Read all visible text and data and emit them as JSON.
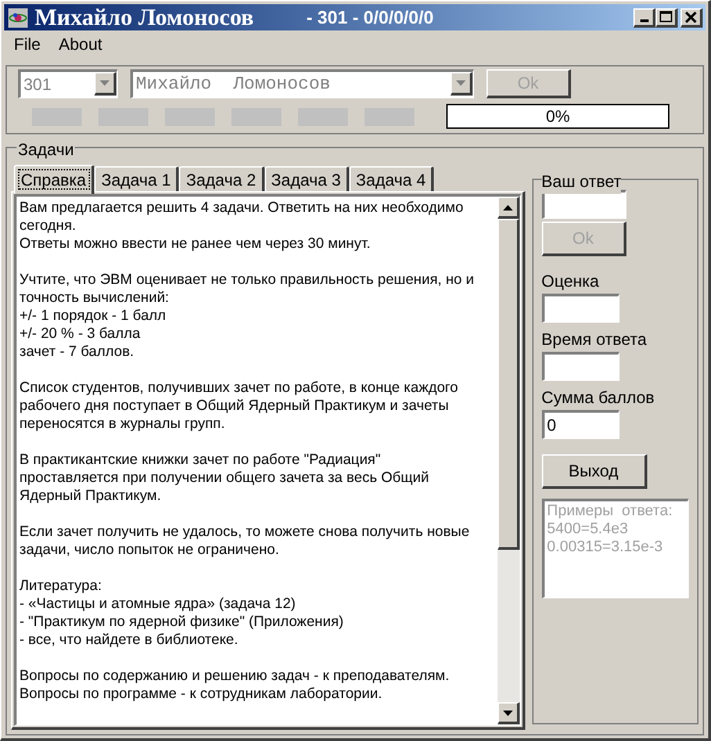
{
  "window": {
    "title": "Михайло Ломоносов",
    "subtitle": "- 301 - 0/0/0/0/0"
  },
  "menu": [
    "File",
    "About"
  ],
  "login": {
    "group": {
      "value": "301",
      "disabled": true
    },
    "student": {
      "value": "Михайло  Ломоносов",
      "disabled": true
    },
    "ok_button": {
      "label": "Ok",
      "disabled": true
    }
  },
  "indicators": [
    {
      "on": false
    },
    {
      "on": false
    },
    {
      "on": false
    },
    {
      "on": false
    },
    {
      "on": false
    },
    {
      "on": false
    }
  ],
  "progress": {
    "level": 0,
    "label": "0%"
  },
  "tasks_group": {
    "title": "Задачи",
    "tabs": [
      {
        "label": "Справка",
        "selected": true
      },
      {
        "label": "Задача 1",
        "selected": false
      },
      {
        "label": "Задача 2",
        "selected": false
      },
      {
        "label": "Задача 3",
        "selected": false
      },
      {
        "label": "Задача 4",
        "selected": false
      }
    ],
    "text": [
      [
        "Вам предлагается решить 4 задачи. Ответить на них необходимо",
        "сегодня.",
        "Ответы можно ввести не ранее чем через 30 минут."
      ],
      [
        "Учтите, что ЭВМ оценивает не только правильность решения, но и",
        "точность вычислений:",
        "+/- 1 порядок - 1 балл",
        "+/- 20 % - 3 балла",
        "зачет - 7 баллов."
      ],
      [
        "Список студентов, получивших зачет по работе, в конце каждого",
        "рабочего дня поступает в Общий Ядерный Практикум и зачеты",
        "переносятся в журналы групп."
      ],
      [
        "В практикантские книжки зачет по работе \"Радиация\"",
        "проставляется при получении общего зачета за весь Общий",
        "Ядерный Практикум."
      ],
      [
        "Если зачет получить не удалось, то можете снова получить новые",
        "задачи, число попыток не ограничено."
      ],
      [
        "Литература:",
        "- «Частицы и атомные ядра» (задача 12)",
        "- \"Практикум по ядерной физике\" (Приложения)",
        "- все, что найдете в библиотеке."
      ],
      [
        "Вопросы по содержанию и решению задач - к преподавателям.",
        "Вопросы по программе - к сотрудникам лаборатории."
      ]
    ]
  },
  "answer_panel": {
    "title": "Ваш ответ",
    "ok_button": {
      "label": "Ok",
      "disabled": true
    },
    "fields": [
      {
        "label": "Оценка"
      },
      {
        "label": "Время ответа"
      },
      {
        "label": "Сумма баллов",
        "value": "0"
      }
    ],
    "exit_button": {
      "label": "Выход",
      "disabled": false
    },
    "examples": [
      "Примеры  ответа:",
      "5400=5.4e3",
      "0.00315=3.15e-3"
    ]
  }
}
